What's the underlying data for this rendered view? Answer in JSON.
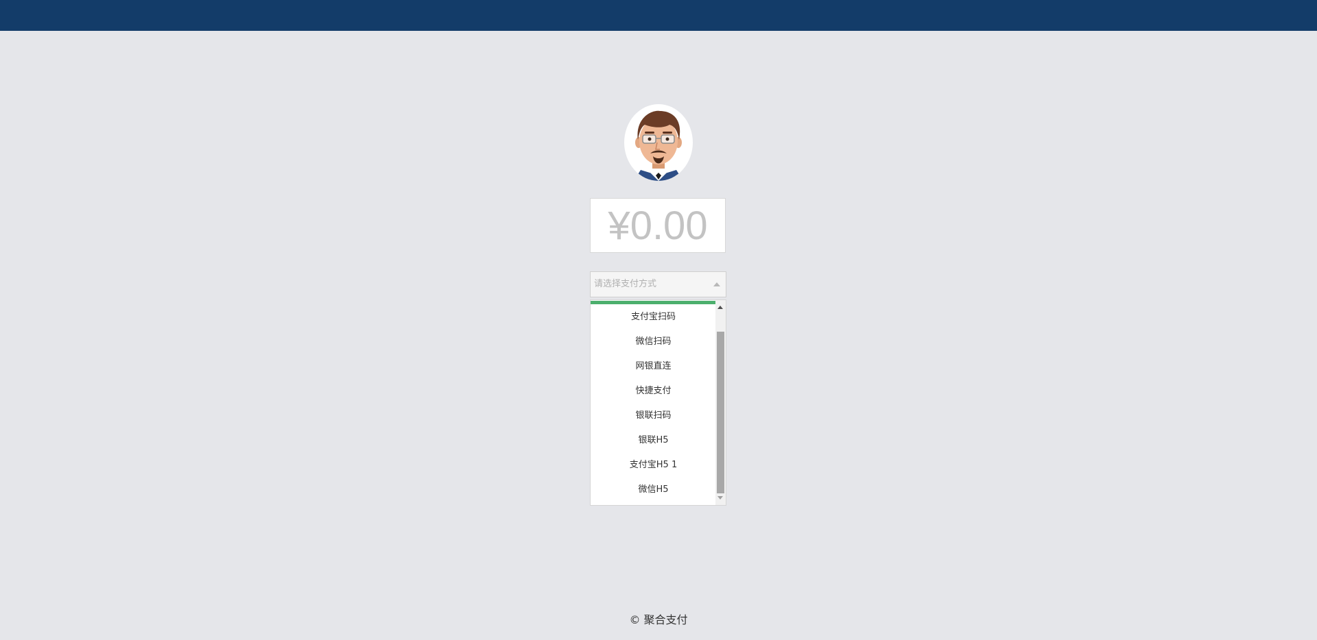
{
  "header": {
    "bar_color": "#133c69"
  },
  "avatar": {
    "icon": "avatar-man-glasses-beard-icon"
  },
  "amount": {
    "currency_symbol": "¥",
    "value": "0.00"
  },
  "payment_select": {
    "placeholder": "请选择支付方式",
    "expanded": true,
    "options": [
      "支付宝扫码",
      "微信扫码",
      "网银直连",
      "快捷支付",
      "银联扫码",
      "银联H5",
      "支付宝H5 1",
      "微信H5"
    ],
    "highlight_color": "#4caf6d"
  },
  "footer": {
    "copyright": "© 聚合支付"
  }
}
